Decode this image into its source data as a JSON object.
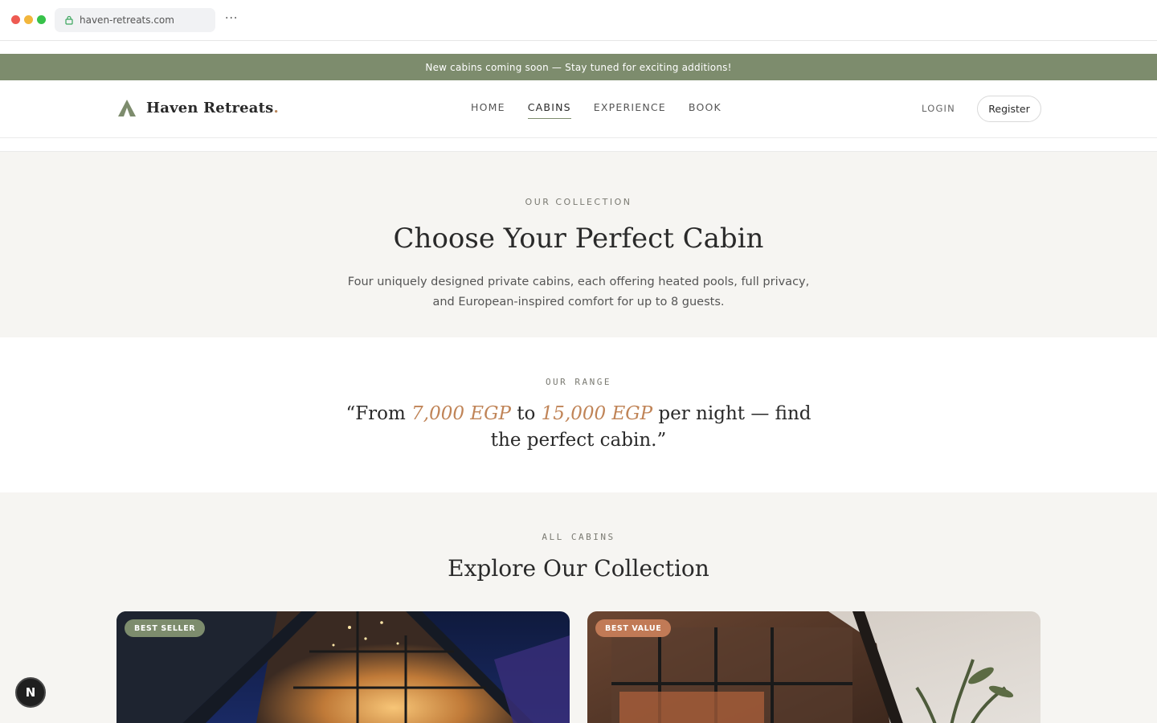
{
  "browser": {
    "url": "haven-retreats.com",
    "more_icon": "more-horizontal-icon",
    "lock_icon": "lock-icon"
  },
  "announcement": "New cabins coming soon — Stay tuned for exciting additions!",
  "header": {
    "logo_icon": "a-frame-cabin-icon",
    "logo_text": "Haven Retreats",
    "logo_dot": ".",
    "nav": [
      {
        "label": "HOME",
        "active": false
      },
      {
        "label": "CABINS",
        "active": true
      },
      {
        "label": "EXPERIENCE",
        "active": false
      },
      {
        "label": "BOOK",
        "active": false
      }
    ],
    "login": "LOGIN",
    "register": "Register"
  },
  "collection": {
    "eyebrow": "OUR COLLECTION",
    "title": "Choose Your Perfect Cabin",
    "description": "Four uniquely designed private cabins, each offering heated pools, full privacy, and European-inspired comfort for up to 8 guests."
  },
  "range": {
    "eyebrow": "OUR RANGE",
    "quote_open": "“From ",
    "price_min": "7,000 EGP",
    "quote_mid": " to ",
    "price_max": "15,000 EGP",
    "quote_end": " per night — find the perfect cabin.”"
  },
  "all_cabins": {
    "eyebrow": "ALL CABINS",
    "title": "Explore Our Collection",
    "cards": [
      {
        "badge": "BEST SELLER"
      },
      {
        "badge": "BEST VALUE"
      }
    ]
  },
  "floating_button": "N",
  "colors": {
    "accent_green": "#7d8c6d",
    "accent_copper": "#c08457",
    "badge_orange": "#c17a56",
    "background_warm": "#f6f5f2"
  }
}
